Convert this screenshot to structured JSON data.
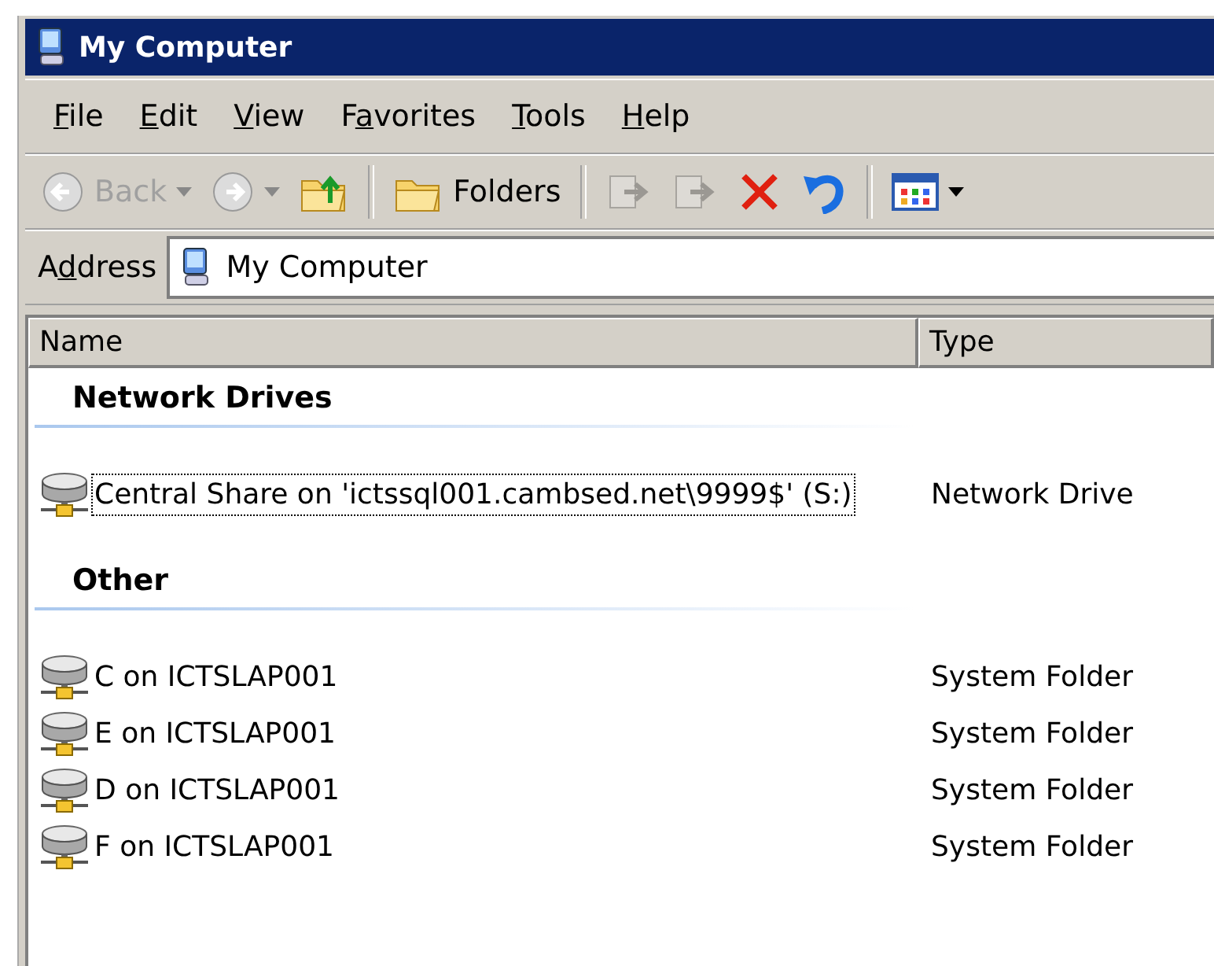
{
  "window": {
    "title": "My Computer"
  },
  "menu": [
    {
      "key": "F",
      "rest": "ile"
    },
    {
      "key": "E",
      "rest": "dit"
    },
    {
      "key": "V",
      "rest": "iew"
    },
    {
      "before": "F",
      "key": "a",
      "rest": "vorites"
    },
    {
      "key": "T",
      "rest": "ools"
    },
    {
      "key": "H",
      "rest": "elp"
    }
  ],
  "toolbar": [
    {
      "kind": "back",
      "label": "Back",
      "disabled": true
    },
    {
      "kind": "forward",
      "disabled": true
    },
    {
      "kind": "up",
      "disabled": false
    },
    {
      "kind": "separator"
    },
    {
      "kind": "folders",
      "label": "Folders",
      "disabled": false
    },
    {
      "kind": "separator"
    },
    {
      "kind": "move",
      "disabled": true
    },
    {
      "kind": "copy",
      "disabled": true
    },
    {
      "kind": "delete",
      "disabled": false
    },
    {
      "kind": "undo",
      "disabled": false
    },
    {
      "kind": "separator"
    },
    {
      "kind": "views",
      "disabled": false
    }
  ],
  "address": {
    "label": {
      "before": "A",
      "key": "d",
      "rest": "dress"
    },
    "value": "My Computer"
  },
  "table": {
    "columns": [
      "Name",
      "Type"
    ],
    "groups": [
      {
        "title": "Network Drives",
        "rows": [
          {
            "name": "Central Share on 'ictssql001.cambsed.net\\9999$' (S:)",
            "type": "Network Drive",
            "focused": true
          }
        ]
      },
      {
        "title": "Other",
        "rows": [
          {
            "name": "C on ICTSLAP001",
            "type": "System Folder",
            "focused": false
          },
          {
            "name": "E on ICTSLAP001",
            "type": "System Folder",
            "focused": false
          },
          {
            "name": "D on ICTSLAP001",
            "type": "System Folder",
            "focused": false
          },
          {
            "name": "F on ICTSLAP001",
            "type": "System Folder",
            "focused": false
          }
        ]
      }
    ]
  }
}
